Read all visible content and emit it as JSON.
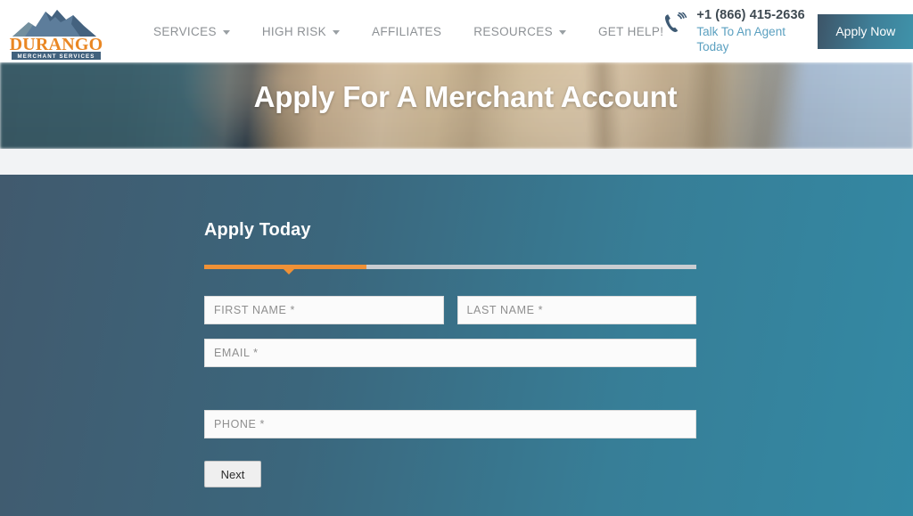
{
  "header": {
    "logo": {
      "brand": "DURANGO",
      "tagline": "MERCHANT SERVICES",
      "icon": "mountain-icon"
    },
    "nav": [
      {
        "label": "SERVICES",
        "has_dropdown": true
      },
      {
        "label": "HIGH RISK",
        "has_dropdown": true
      },
      {
        "label": "AFFILIATES",
        "has_dropdown": false
      },
      {
        "label": "RESOURCES",
        "has_dropdown": true
      },
      {
        "label": "GET HELP!",
        "has_dropdown": false
      }
    ],
    "contact": {
      "icon": "phone-ringing-icon",
      "phone": "+1 (866) 415-2636",
      "subtitle": "Talk To An Agent Today"
    },
    "apply_now_label": "Apply Now"
  },
  "hero": {
    "title": "Apply For A Merchant Account"
  },
  "form": {
    "heading": "Apply Today",
    "progress": {
      "percent": 33,
      "fill_color": "#ef9137",
      "track_color": "#c9cdd1"
    },
    "fields": {
      "first_name": "FIRST NAME *",
      "last_name": "LAST NAME *",
      "email": "EMAIL *",
      "phone": "PHONE *"
    },
    "next_label": "Next"
  },
  "colors": {
    "brand_orange": "#e98724",
    "brand_blue": "#41617d",
    "accent_teal": "#3389a4",
    "link_blue": "#5ba0c0",
    "gap_band": "#f2f3f5"
  }
}
